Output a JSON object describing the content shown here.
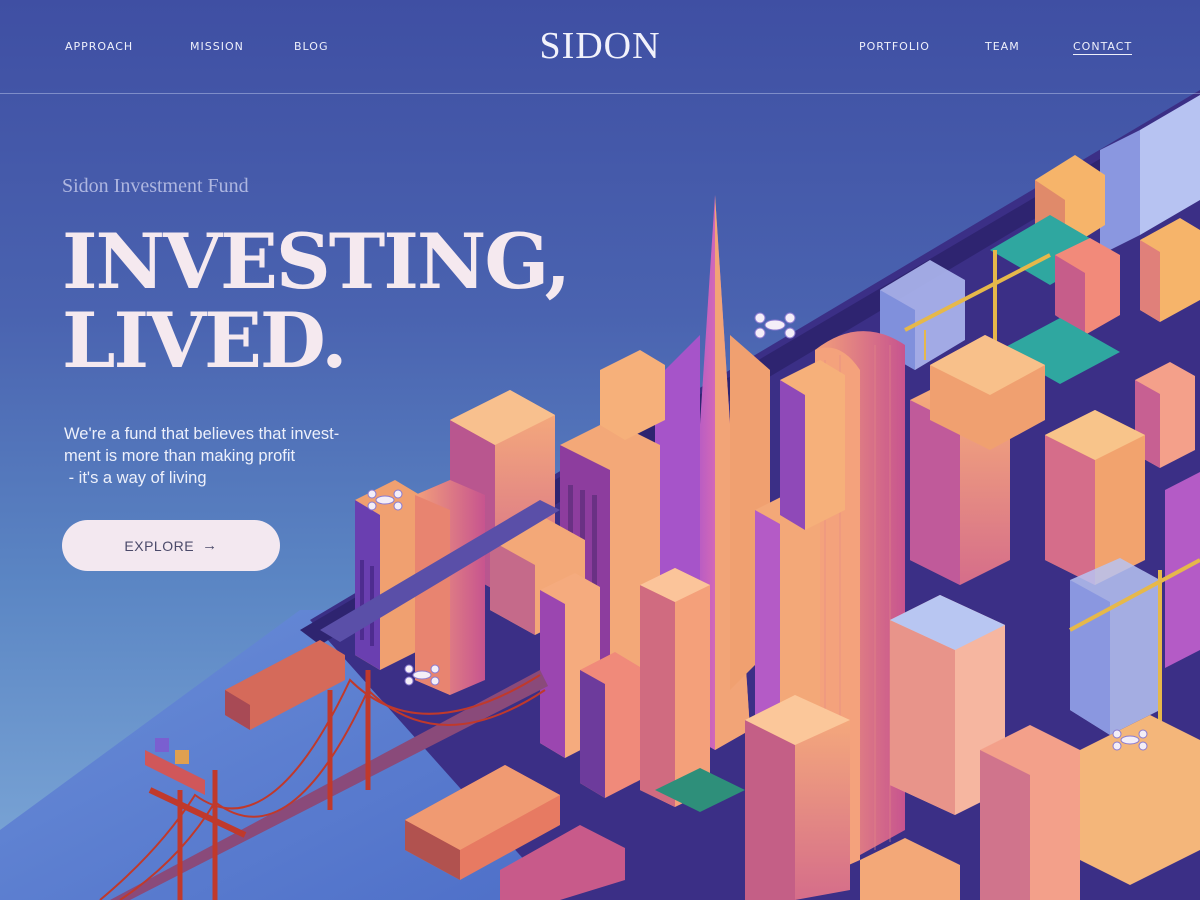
{
  "nav": {
    "left": [
      "APPROACH",
      "MISSION",
      "BLOG"
    ],
    "logo": "SIDON",
    "right": [
      "PORTFOLIO",
      "TEAM",
      "CONTACT"
    ]
  },
  "hero": {
    "eyebrow": "Sidon Investment Fund",
    "headline": [
      "INVESTING,",
      "LIVED."
    ],
    "description": [
      "We're a fund that believes that invest-",
      "ment is more than making profit",
      " - it's a way of living"
    ],
    "cta_label": "EXPLORE",
    "cta_icon": "arrow-right-icon"
  },
  "illustration": {
    "subject": "isometric-city",
    "colors": {
      "water": "#5a7fd0",
      "ground": "#3b2f86",
      "building_warm": "#f0946a",
      "building_purple": "#8b4fc4",
      "bridge": "#c0392b",
      "crane": "#e6b84a"
    }
  }
}
